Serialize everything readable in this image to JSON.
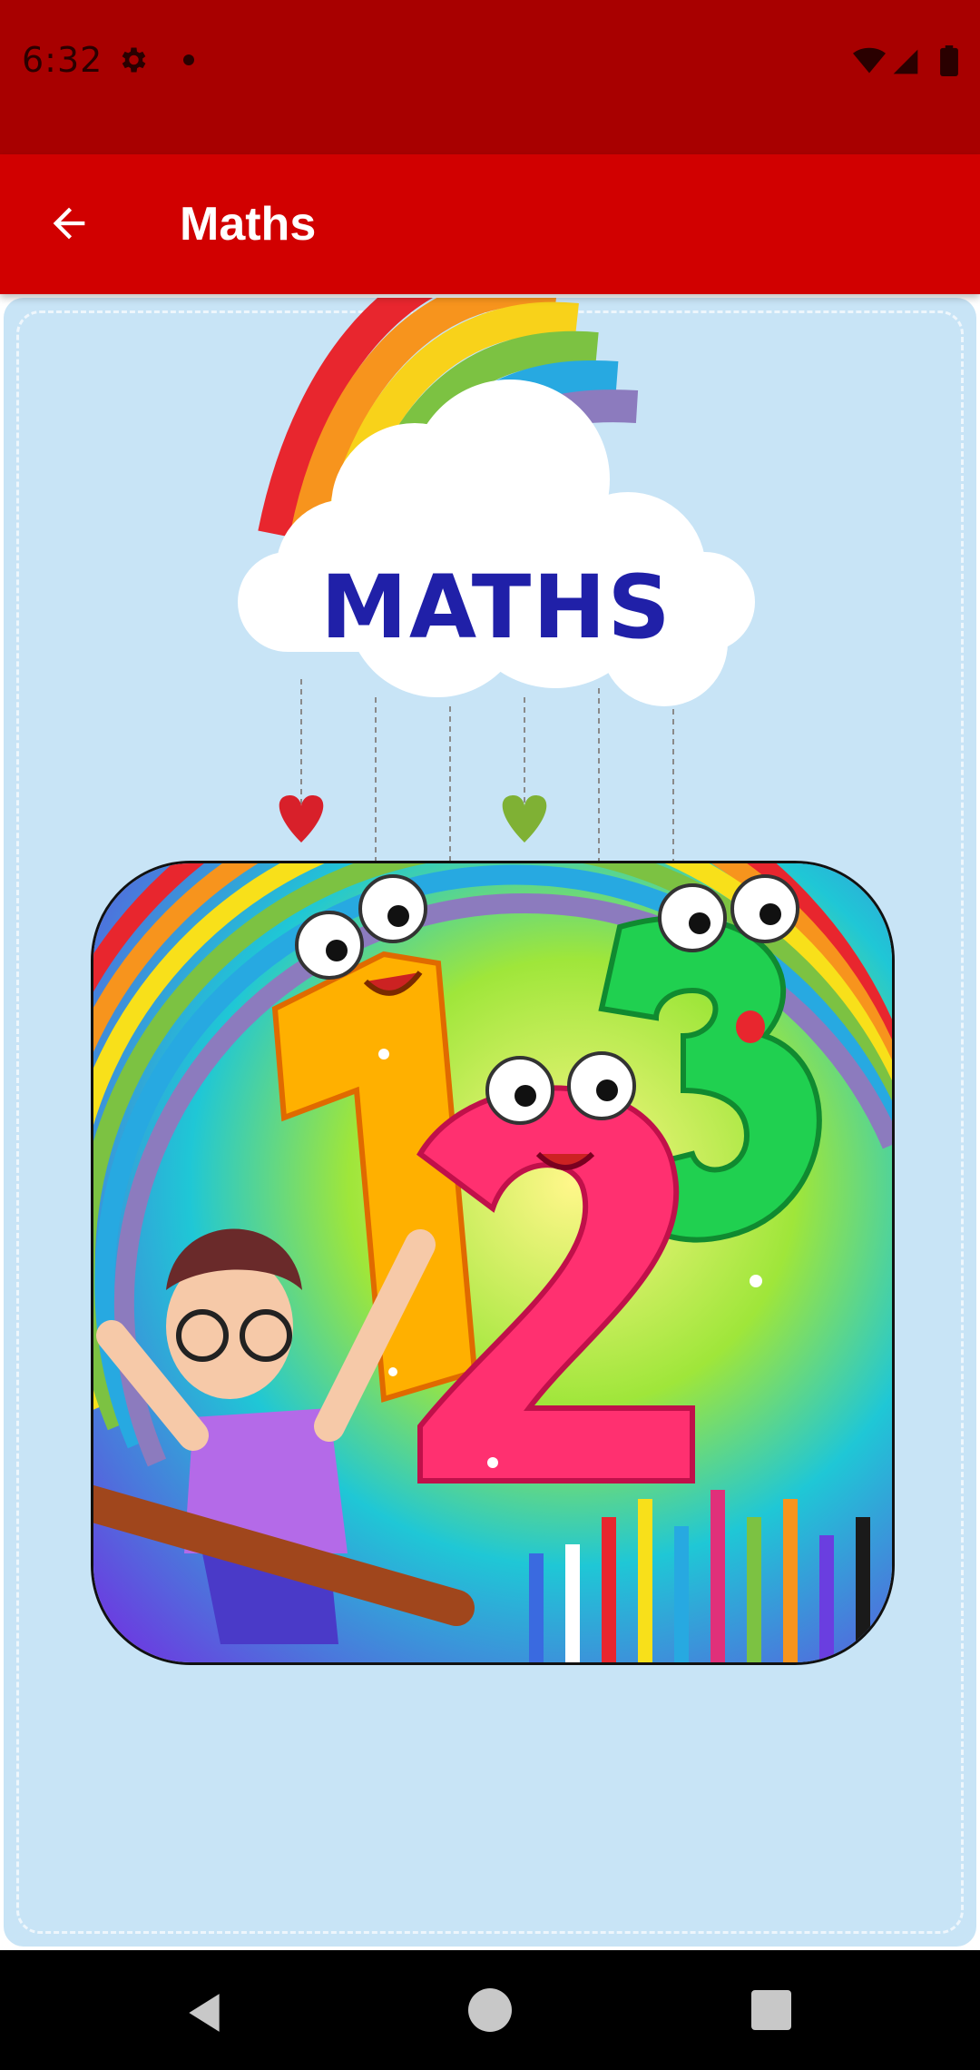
{
  "status_bar": {
    "time": "6:32",
    "icons": [
      "gear-icon",
      "dot-icon",
      "wifi-icon",
      "signal-icon",
      "battery-icon"
    ]
  },
  "app_bar": {
    "back_icon": "arrow-back-icon",
    "title": "Maths"
  },
  "card": {
    "banner_title": "MATHS",
    "illustration": "numbers-123-illustration"
  },
  "nav_bar": {
    "icons": [
      "nav-back-icon",
      "nav-home-icon",
      "nav-recents-icon"
    ]
  },
  "colors": {
    "status_bar": "#a80000",
    "app_bar": "#d10000",
    "card_background": "#c8e4f6",
    "banner_text": "#2020a8"
  }
}
